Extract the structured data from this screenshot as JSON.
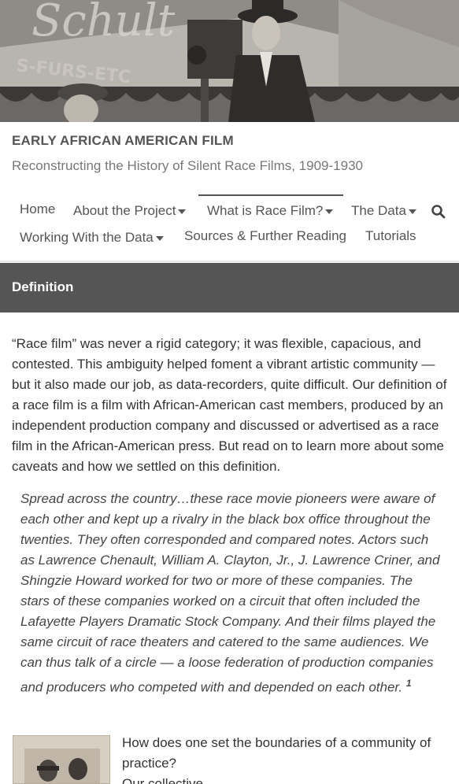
{
  "hero": {
    "image_label": "vintage-film-crew-photo",
    "sign_text": "Schult",
    "banner_text": "S-FURS-ETC"
  },
  "site": {
    "title": "EARLY AFRICAN AMERICAN FILM",
    "description": "Reconstructing the History of Silent Race Films, 1909-1930"
  },
  "nav": {
    "home": "Home",
    "about": "About the Project",
    "race_film": "What is Race Film?",
    "data": "The Data",
    "working": "Working With the Data",
    "sources": "Sources & Further Reading",
    "tutorials": "Tutorials",
    "active": "What is Race Film?"
  },
  "section": {
    "title": "Definition"
  },
  "content": {
    "intro": "“Race film” was never a rigid category; it was flexible, capacious, and contested. This ambiguity helped foment a vibrant artistic community — but it also made our job, as data-recorders, quite difficult. Our definition of a race film is a film with African-American cast members, produced by an independent production company and discussed or advertised as a race film in the African-American press. But read on to learn more about some caveats and how we settled on this definition.",
    "quote": "Spread across the country…these race movie pioneers were aware of each other and kept up a rivalry in the black box office throughout the twenties. They often corresponded and compared notes. Actors such as Lawrence Chenault, William A. Clayton, Jr., J. Lawrence Criner, and Shingzie Howard worked for two or more of these companies. The stars of these companies worked on a circuit that often included the Lafayette Players Dramatic Stock Company. And their films played the same circuit of race theaters and catered to the same audiences. We can thus talk of a circle — a loose federation of production companies and producers who competed with and depended on each other.",
    "footnote": "1",
    "question": "How does one set the boundaries of a community of practice?",
    "next_line": "Our collective…"
  },
  "colors": {
    "section_bar": "#555555",
    "text": "#333333",
    "nav_text": "#555555"
  }
}
